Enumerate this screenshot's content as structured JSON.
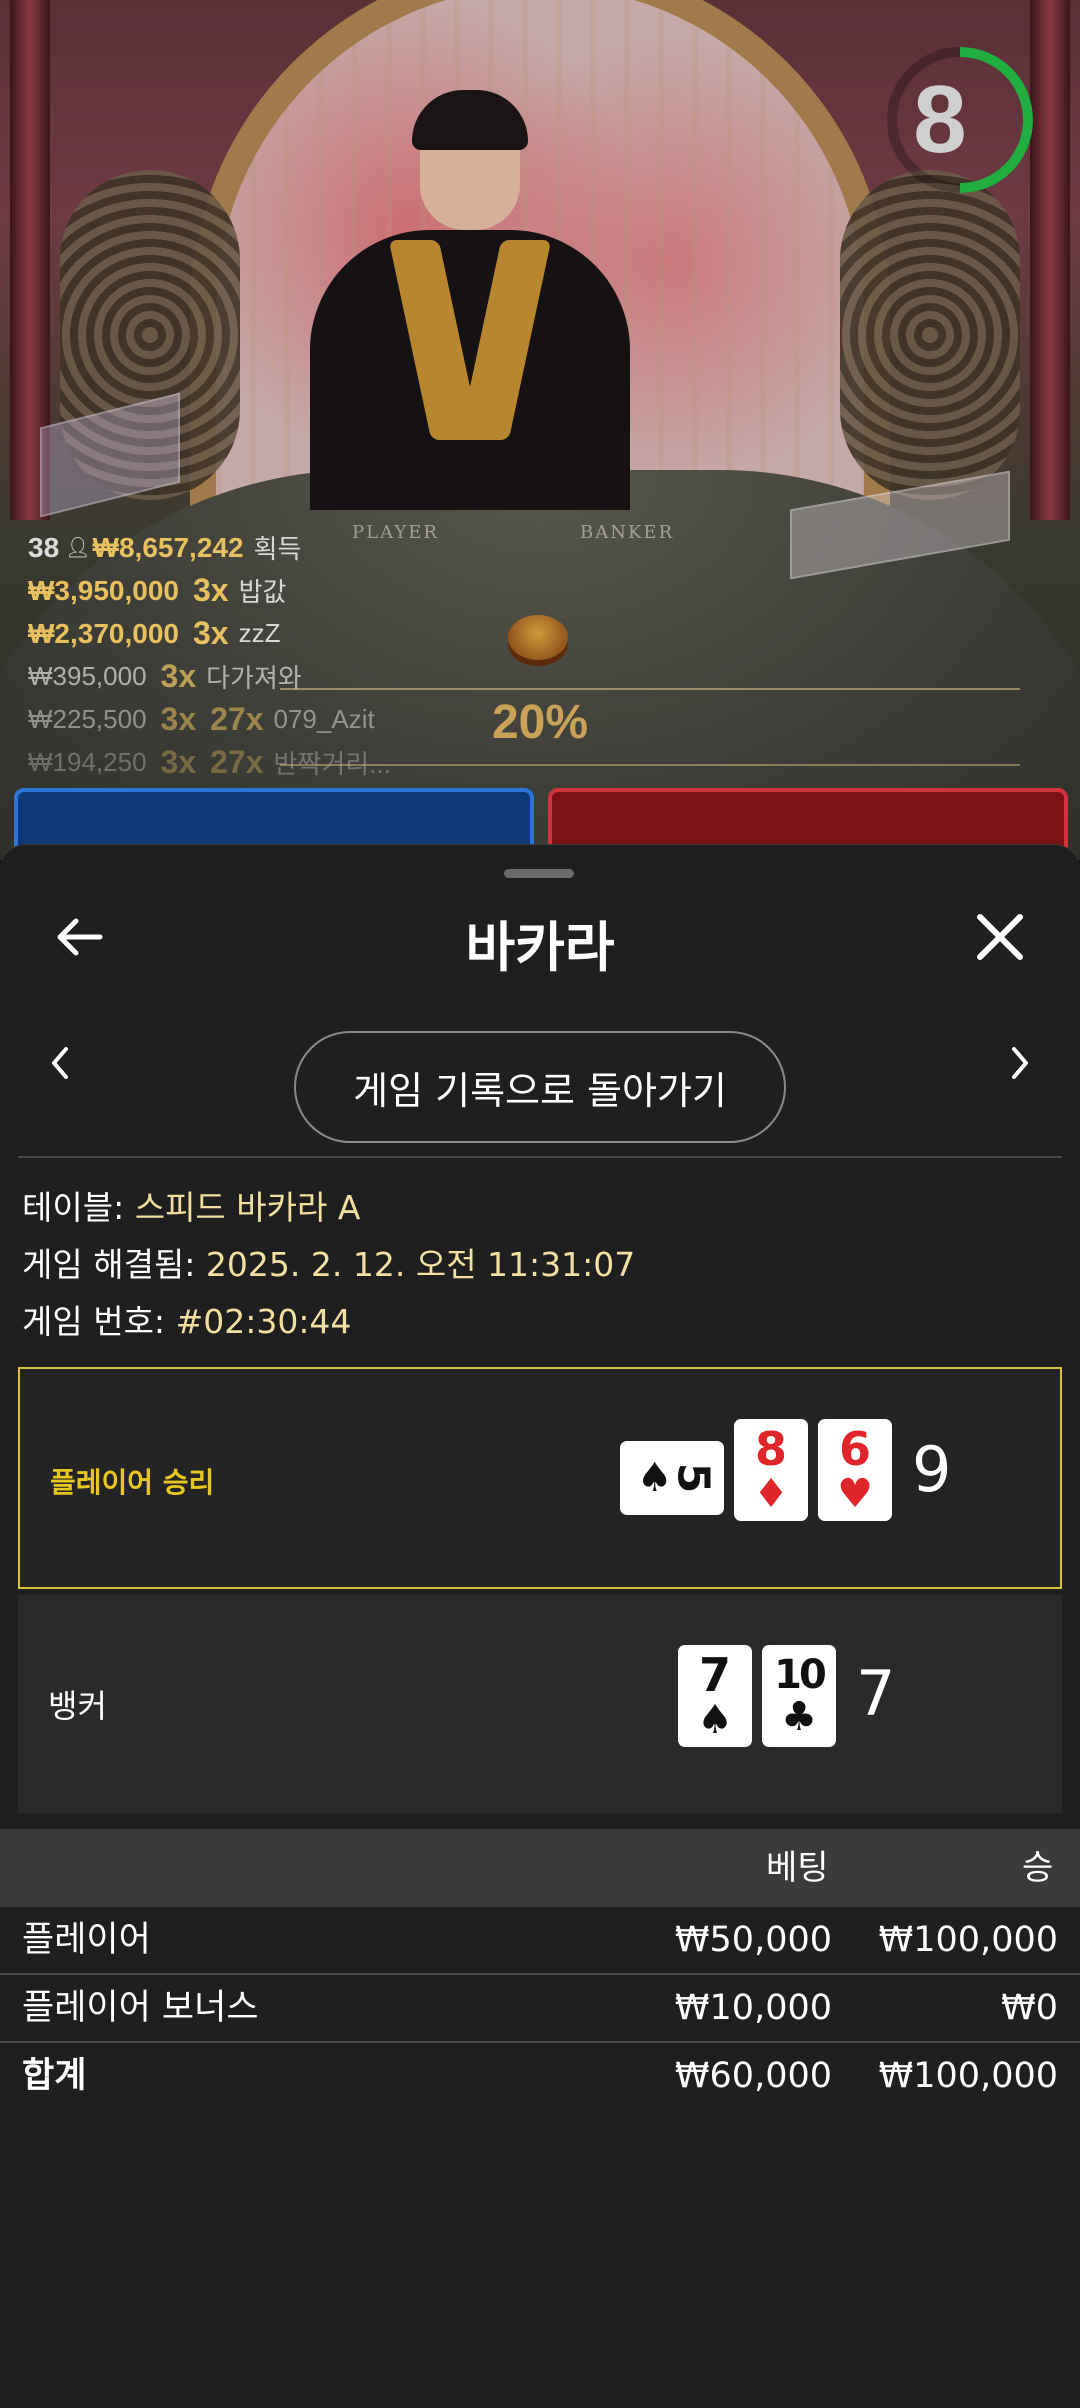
{
  "live": {
    "timer": "8",
    "timer_fraction": 0.5,
    "felt_player_label": "PLAYER",
    "felt_banker_label": "BANKER",
    "winners_total": {
      "count": "38",
      "amount": "₩8,657,242",
      "label": "획득"
    },
    "winners": [
      {
        "amount": "₩3,950,000",
        "mult": "3x",
        "name": "밥값"
      },
      {
        "amount": "₩2,370,000",
        "mult": "3x",
        "name": "zzZ"
      },
      {
        "amount": "₩395,000",
        "mult": "3x",
        "name": "다가져와"
      },
      {
        "amount": "₩225,500",
        "mult": "3x",
        "mult2": "27x",
        "name": "079_Azit"
      },
      {
        "amount": "₩194,250",
        "mult": "3x",
        "mult2": "27x",
        "name": "반짝거리..."
      }
    ],
    "bonus_percent": "20%"
  },
  "sheet": {
    "title": "바카라",
    "history_button": "게임 기록으로 돌아가기",
    "table_label": "테이블:",
    "table_value": "스피드 바카라 A",
    "resolved_label": "게임 해결됨:",
    "resolved_value": "2025. 2. 12. 오전 11:31:07",
    "game_no_label": "게임 번호:",
    "game_no_value": "#02:30:44",
    "player_result": {
      "label": "플레이어 승리",
      "score": "9",
      "cards": [
        {
          "rank": "5",
          "suit": "♠",
          "color": "black",
          "rotated": true
        },
        {
          "rank": "8",
          "suit": "♦",
          "color": "red"
        },
        {
          "rank": "6",
          "suit": "♥",
          "color": "red"
        }
      ]
    },
    "banker_result": {
      "label": "뱅커",
      "score": "7",
      "cards": [
        {
          "rank": "7",
          "suit": "♠",
          "color": "black"
        },
        {
          "rank": "10",
          "suit": "♣",
          "color": "black"
        }
      ]
    },
    "bets_table": {
      "headers": {
        "bet": "베팅",
        "win": "승"
      },
      "rows": [
        {
          "name": "플레이어",
          "bet": "₩50,000",
          "win": "₩100,000"
        },
        {
          "name": "플레이어 보너스",
          "bet": "₩10,000",
          "win": "₩0"
        }
      ],
      "total": {
        "name": "합계",
        "bet": "₩60,000",
        "win": "₩100,000"
      }
    }
  }
}
